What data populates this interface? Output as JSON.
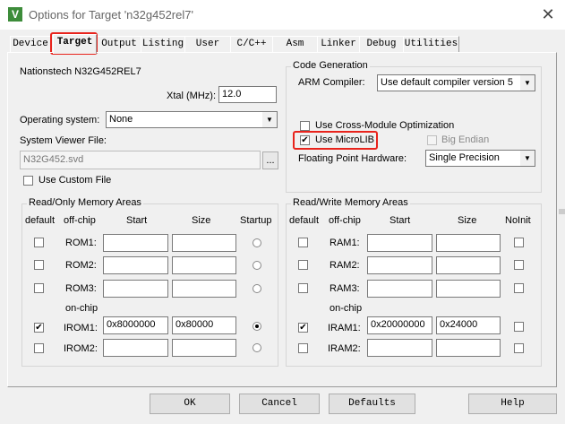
{
  "window": {
    "title": "Options for Target 'n32g452rel7'",
    "icon_letter": "V"
  },
  "tabs": [
    "Device",
    "Target",
    "Output",
    "Listing",
    "User",
    "C/C++",
    "Asm",
    "Linker",
    "Debug",
    "Utilities"
  ],
  "active_tab": "Target",
  "device_name": "Nationstech N32G452REL7",
  "xtal": {
    "label": "Xtal (MHz):",
    "value": "12.0"
  },
  "os": {
    "label": "Operating system:",
    "value": "None"
  },
  "svd": {
    "label": "System Viewer File:",
    "value": "N32G452.svd",
    "browse": "...",
    "custom_label": "Use Custom File"
  },
  "codegen": {
    "title": "Code Generation",
    "compiler_label": "ARM Compiler:",
    "compiler_value": "Use default compiler version 5",
    "cross_module_label": "Use Cross-Module Optimization",
    "microlib_label": "Use MicroLIB",
    "big_endian_label": "Big Endian",
    "fpu_label": "Floating Point Hardware:",
    "fpu_value": "Single Precision"
  },
  "ro": {
    "title": "Read/Only Memory Areas",
    "headers": {
      "default": "default",
      "chip": "off-chip",
      "start": "Start",
      "size": "Size",
      "extra": "Startup"
    },
    "on_chip": "on-chip",
    "rows": [
      {
        "name": "ROM1:",
        "start": "",
        "size": ""
      },
      {
        "name": "ROM2:",
        "start": "",
        "size": ""
      },
      {
        "name": "ROM3:",
        "start": "",
        "size": ""
      },
      {
        "name": "IROM1:",
        "start": "0x8000000",
        "size": "0x80000"
      },
      {
        "name": "IROM2:",
        "start": "",
        "size": ""
      }
    ]
  },
  "rw": {
    "title": "Read/Write Memory Areas",
    "headers": {
      "default": "default",
      "chip": "off-chip",
      "start": "Start",
      "size": "Size",
      "extra": "NoInit"
    },
    "on_chip": "on-chip",
    "rows": [
      {
        "name": "RAM1:",
        "start": "",
        "size": ""
      },
      {
        "name": "RAM2:",
        "start": "",
        "size": ""
      },
      {
        "name": "RAM3:",
        "start": "",
        "size": ""
      },
      {
        "name": "IRAM1:",
        "start": "0x20000000",
        "size": "0x24000"
      },
      {
        "name": "IRAM2:",
        "start": "",
        "size": ""
      }
    ]
  },
  "buttons": {
    "ok": "OK",
    "cancel": "Cancel",
    "defaults": "Defaults",
    "help": "Help"
  },
  "check_mark": "✔",
  "close_glyph": "✕",
  "dropdown_glyph": "▼",
  "accent_color": "#e8231c"
}
